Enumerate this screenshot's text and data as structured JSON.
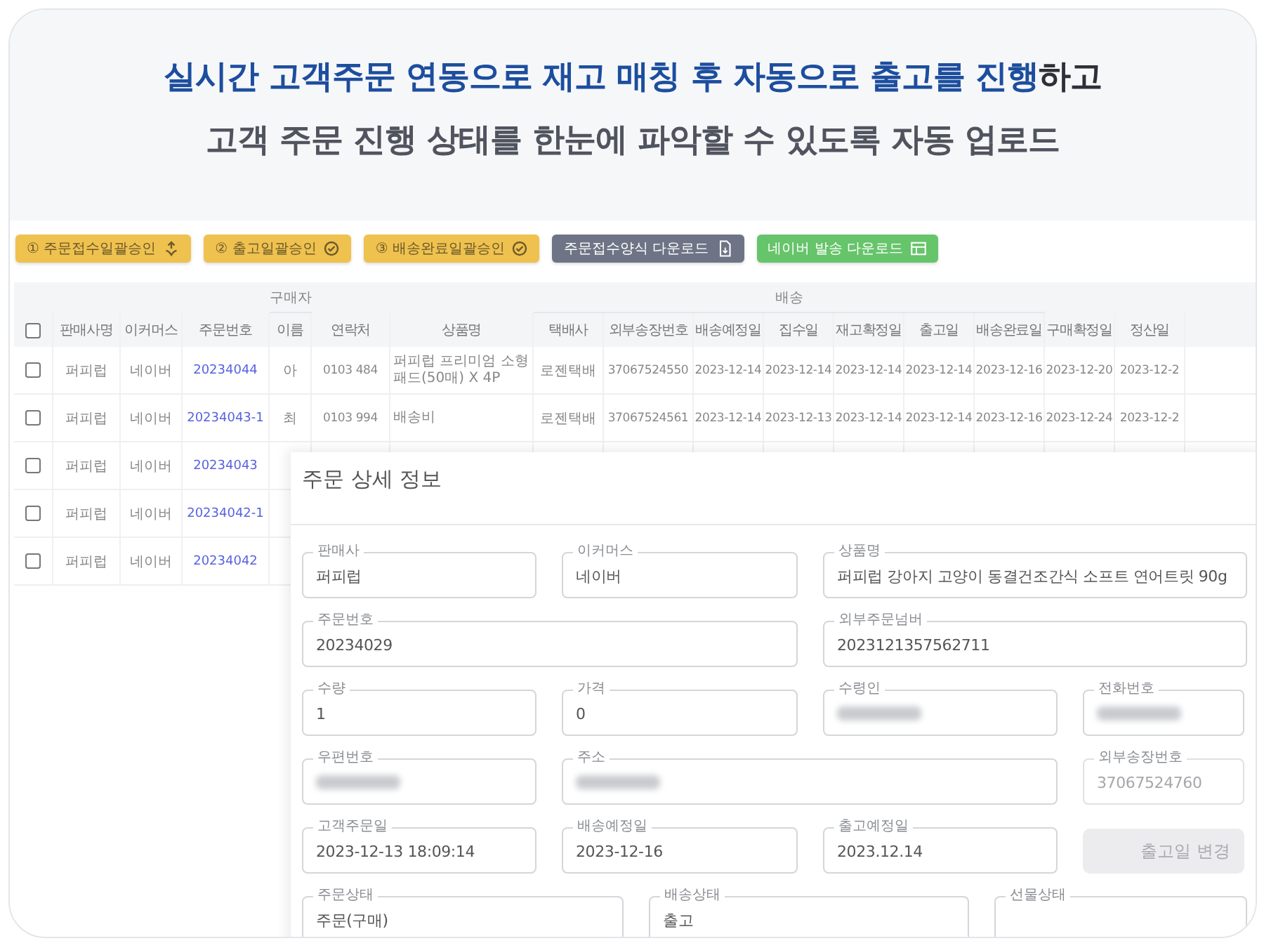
{
  "headline": [
    "**실시간 고객주문 연동으로 재고 매칭 후 자동으로 출고를 진행**하고",
    "고객 주문 진행 상태를 한눈에 파악할 수 있도록 자동 업로드"
  ],
  "toolbar": [
    {
      "label": "① 주문접수일괄승인",
      "color": "#efc14f"
    },
    {
      "label": "② 출고일괄승인",
      "color": "#efc14f"
    },
    {
      "label": "③ 배송완료일괄승인",
      "color": "#efc14f"
    },
    {
      "label": "주문접수양식 다운로드",
      "color": "#6e7485"
    },
    {
      "label": "네이버 발송 다운로드",
      "color": "#66c46a"
    }
  ],
  "table": {
    "select_all": {
      "checked": false
    },
    "column_groups": [
      "구매자",
      "배송"
    ],
    "columns": [
      {
        "label": "판매사명",
        "kind": "text"
      },
      {
        "label": "이커머스",
        "kind": "text"
      },
      {
        "label": "주문번호",
        "kind": "link"
      },
      {
        "label": "이름",
        "kind": "text"
      },
      {
        "label": "연락처",
        "kind": "num"
      },
      {
        "label": "상품명",
        "kind": "left"
      },
      {
        "label": "택배사",
        "kind": "text"
      },
      {
        "label": "외부송장번호",
        "kind": "num"
      },
      {
        "label": "배송예정일",
        "kind": "num"
      },
      {
        "label": "집수일",
        "kind": "num"
      },
      {
        "label": "재고확정일",
        "kind": "num"
      },
      {
        "label": "출고일",
        "kind": "num"
      },
      {
        "label": "배송완료일",
        "kind": "num"
      },
      {
        "label": "구매확정일",
        "kind": "num"
      },
      {
        "label": "정산일",
        "kind": "num"
      }
    ],
    "rows": [
      {
        "checked": false,
        "cells": [
          "퍼피럽",
          "네이버",
          "20234044",
          "아",
          "0103 484",
          "퍼피럽 프리미엄 소형 패드(50매) X 4P",
          "로젠택배",
          "37067524550",
          "2023-12-14",
          "2023-12-14",
          "2023-12-14",
          "2023-12-14",
          "2023-12-16",
          "2023-12-20",
          "2023-12-2"
        ]
      },
      {
        "checked": false,
        "cells": [
          "퍼피럽",
          "네이버",
          "20234043-1",
          "최",
          "0103 994",
          "배송비",
          "로젠택배",
          "37067524561",
          "2023-12-14",
          "2023-12-13",
          "2023-12-14",
          "2023-12-14",
          "2023-12-16",
          "2023-12-24",
          "2023-12-2"
        ]
      },
      {
        "checked": false,
        "cells": [
          "퍼피럽",
          "네이버",
          "20234043"
        ]
      },
      {
        "checked": false,
        "cells": [
          "퍼피럽",
          "네이버",
          "20234042-1"
        ]
      },
      {
        "checked": false,
        "cells": [
          "퍼피럽",
          "네이버",
          "20234042"
        ]
      }
    ]
  },
  "modal": {
    "title": "주문 상세 정보",
    "fields": [
      {
        "kind": "text",
        "label": "판매사",
        "value": "퍼피럽",
        "disabled": false
      },
      {
        "kind": "text",
        "label": "이커머스",
        "value": "네이버",
        "disabled": false
      },
      {
        "kind": "text",
        "label": "상품명",
        "value": "퍼피럽 강아지 고양이 동결건조간식 소프트 연어트릿 90g",
        "disabled": false
      },
      {
        "kind": "text",
        "label": "주문번호",
        "value": "20234029",
        "disabled": false
      },
      {
        "kind": "text",
        "label": "외부주문넘버",
        "value": "2023121357562711",
        "disabled": false
      },
      {
        "kind": "text",
        "label": "수량",
        "value": "1",
        "disabled": false
      },
      {
        "kind": "text",
        "label": "가격",
        "value": "0",
        "disabled": false
      },
      {
        "kind": "blurred",
        "label": "수령인",
        "disabled": false
      },
      {
        "kind": "blurred",
        "label": "전화번호",
        "disabled": false
      },
      {
        "kind": "blurred",
        "label": "우편번호",
        "disabled": false
      },
      {
        "kind": "blurred",
        "label": "주소",
        "disabled": false
      },
      {
        "kind": "text",
        "label": "외부송장번호",
        "value": "37067524760",
        "disabled": true
      },
      {
        "kind": "text",
        "label": "고객주문일",
        "value": "2023-12-13 18:09:14",
        "disabled": false
      },
      {
        "kind": "text",
        "label": "배송예정일",
        "value": "2023-12-16",
        "disabled": false
      },
      {
        "kind": "text",
        "label": "출고예정일",
        "value": "2023.12.14",
        "disabled": false
      },
      {
        "kind": "button",
        "label": "출고일 변경",
        "disabled": true
      },
      {
        "kind": "text",
        "label": "주문상태",
        "value": "주문(구매)",
        "disabled": false
      },
      {
        "kind": "text",
        "label": "배송상태",
        "value": "출고",
        "disabled": false
      },
      {
        "kind": "text",
        "label": "선물상태",
        "disabled": false
      }
    ]
  }
}
